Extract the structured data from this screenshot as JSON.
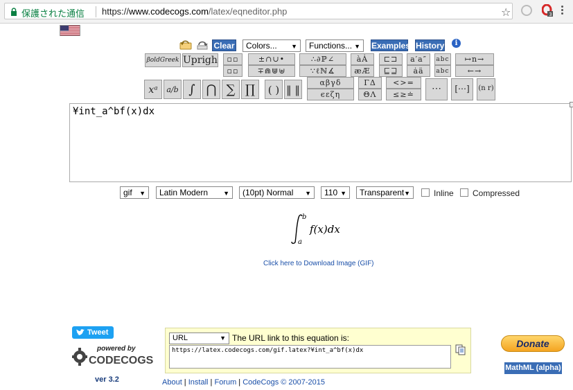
{
  "browser": {
    "secure_label": "保護された通信",
    "url_scheme": "https://",
    "url_host": "www.codecogs.com",
    "url_path": "/latex/eqneditor.php",
    "ext_badge": "3"
  },
  "toolbar": {
    "clear": "Clear",
    "colors": "Colors...",
    "functions": "Functions...",
    "examples": "Examples",
    "history": "History",
    "info": "i"
  },
  "palette": {
    "boldgreek": "βoldGreek",
    "upright": "Upright",
    "xa": "xᵃ",
    "frac": "a/b",
    "integral": "∫",
    "cap": "⋂",
    "sum": "∑",
    "prod": "∏",
    "paren": "( )",
    "norm": "‖ ‖",
    "r1": [
      "▫▫",
      "±∩∪•",
      "∴∂ℙ∠",
      "àȦ",
      "⊏⊐",
      "a′a″",
      "abc",
      "↦n→"
    ],
    "r2": [
      "▫▫",
      "∓⋒⋓⊎",
      "∵ℓℕ∡",
      "æÆ",
      "⊑⊒",
      "ȧä",
      "abc",
      "←→"
    ],
    "r3": [
      "αβγδ",
      "ΓΔ",
      "<>=",
      "⋯",
      "[⋯]",
      "(n r)"
    ],
    "r4": [
      "ϵεζη",
      "ΘΛ",
      "≤≥≐"
    ]
  },
  "editor": {
    "content": "¥int_a^bf(x)dx"
  },
  "options": {
    "format": "gif",
    "font": "Latin Modern",
    "size": "(10pt) Normal",
    "dpi": "110",
    "background": "Transparent",
    "inline_label": "Inline",
    "compressed_label": "Compressed"
  },
  "download_link": "Click here to Download Image (GIF)",
  "bottom": {
    "tweet": "Tweet",
    "powered_by": "powered by",
    "brand": "CODECOGS",
    "version": "ver 3.2",
    "url_type": "URL",
    "url_label": "The URL link to this equation is:",
    "url_value": "https://latex.codecogs.com/gif.latex?¥int_a^bf(x)dx",
    "donate": "Donate",
    "mathml": "MathML (alpha)"
  },
  "footer": {
    "about": "About",
    "install": "Install",
    "forum": "Forum",
    "copyright": "CodeCogs © 2007-2015"
  },
  "colors": {
    "accent_blue": "#3a6db5",
    "secure_green": "#0b8043",
    "url_panel": "#ffffd0"
  }
}
